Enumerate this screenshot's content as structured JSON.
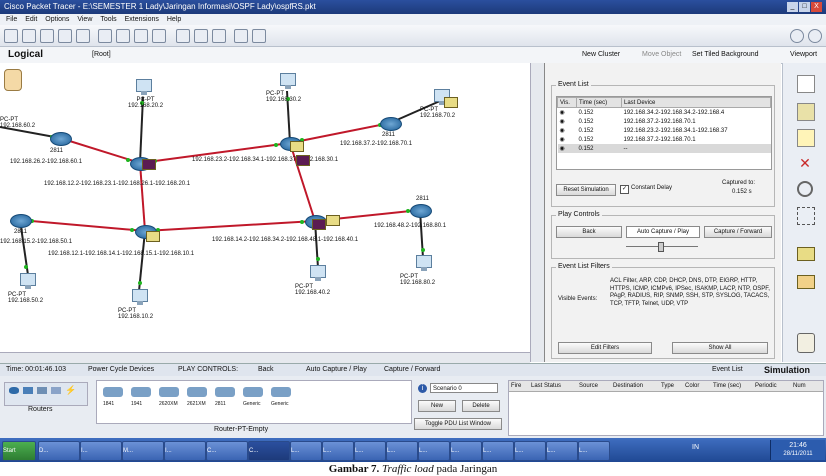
{
  "window": {
    "title": "Cisco Packet Tracer - E:\\SEMESTER 1 Lady\\Jaringan Informasi\\OSPF Lady\\ospfRS.pkt",
    "controls": [
      "_",
      "□",
      "X"
    ]
  },
  "menu": [
    "File",
    "Edit",
    "Options",
    "View",
    "Tools",
    "Extensions",
    "Help"
  ],
  "subbar": {
    "mode": "Logical",
    "root": "[Root]",
    "new_cluster": "New Cluster",
    "move_object": "Move Object",
    "set_tiled": "Set Tiled Background",
    "viewport": "Viewport"
  },
  "topology": {
    "nodes": [
      {
        "type": "pc",
        "label": "PC-PT\n192.168.20.2"
      },
      {
        "type": "pc",
        "label": "PC-PT\n192.168.30.2"
      },
      {
        "type": "pc",
        "label": "PC-PT\n192.168.70.2"
      },
      {
        "type": "pc",
        "label": "PC-PT\n192.168.60.2"
      },
      {
        "type": "pc",
        "label": "PC-PT\n192.168.50.2"
      },
      {
        "type": "pc",
        "label": "PC-PT\n192.168.10.2"
      },
      {
        "type": "pc",
        "label": "PC-PT\n192.168.40.2"
      },
      {
        "type": "pc",
        "label": "PC-PT\n192.168.80.2"
      },
      {
        "type": "router",
        "label": "2811"
      },
      {
        "type": "router",
        "label": "2811"
      },
      {
        "type": "router",
        "label": "2811"
      },
      {
        "type": "router",
        "label": "2811"
      },
      {
        "type": "router",
        "label": "2811"
      },
      {
        "type": "router",
        "label": "2811"
      }
    ],
    "link_labels": [
      "192.168.26.2-192.168.60.1",
      "192.168.12.2-192.168.23.1-192.168.26.1-192.168.20.1",
      "192.168.23.2-192.168.34.1-192.168.37.1-192.168.30.1",
      "192.168.37.2-192.168.70.1",
      "192.168.15.2-192.168.50.1",
      "192.168.12.1-192.168.14.1-192.168.15.1-192.168.10.1",
      "192.168.14.2-192.168.34.2-192.168.48.1-192.168.40.1",
      "192.168.48.2-192.168.80.1"
    ]
  },
  "event_list": {
    "title": "Event List",
    "headers": [
      "Vis.",
      "Time (sec)",
      "Last Device"
    ],
    "rows": [
      {
        "time": "0.152",
        "device": "192.168.34.2-192.168.34.2-192.168.4"
      },
      {
        "time": "0.152",
        "device": "192.168.37.2-192.168.70.1"
      },
      {
        "time": "0.152",
        "device": "192.168.23.2-192.168.34.1-192.168.37"
      },
      {
        "time": "0.152",
        "device": "192.168.37.2-192.168.70.1"
      },
      {
        "time": "0.152",
        "device": "--"
      }
    ],
    "reset_label": "Reset Simulation",
    "constant_delay": "Constant Delay",
    "captured_to_label": "Captured to:",
    "captured_to_value": "0.152 s"
  },
  "play_controls": {
    "title": "Play Controls",
    "back": "Back",
    "auto_capture": "Auto Capture / Play",
    "capture_forward": "Capture / Forward"
  },
  "filters": {
    "title": "Event List Filters",
    "visible_events_label": "Visible Events:",
    "visible_events": "ACL Filter, ARP, CDP, DHCP, DNS, DTP, EIGRP, HTTP, HTTPS, ICMP, ICMPv6, IPSec, ISAKMP, LACP, NTP, OSPF, PAgP, RADIUS, RIP, SNMP, SSH, STP, SYSLOG, TACACS, TCP, TFTP, Telnet, UDP, VTP",
    "edit_filters": "Edit Filters",
    "show_all": "Show All"
  },
  "statusbar": {
    "time": "Time: 00:01:46.103",
    "power_cycle": "Power Cycle Devices",
    "play_controls": "PLAY CONTROLS:",
    "back": "Back",
    "auto_capture": "Auto Capture / Play",
    "capture_forward": "Capture / Forward",
    "event_list": "Event List",
    "simulation": "Simulation"
  },
  "device_box": {
    "category": "Routers",
    "models": [
      "1841",
      "1941",
      "2620XM",
      "2621XM",
      "2811",
      "Generic",
      "Generic"
    ],
    "selected": "Router-PT-Empty"
  },
  "scenario": {
    "value": "Scenario 0",
    "new": "New",
    "delete": "Delete",
    "toggle": "Toggle PDU List Window"
  },
  "pdu_headers": [
    "Fire",
    "Last Status",
    "Source",
    "Destination",
    "Type",
    "Color",
    "Time (sec)",
    "Periodic",
    "Num"
  ],
  "taskbar": {
    "start": "Start",
    "items": [
      "D...",
      "I...",
      "M...",
      "I...",
      "C...",
      "C...",
      "L...",
      "L...",
      "L...",
      "L...",
      "L...",
      "L...",
      "L...",
      "L...",
      "L...",
      "L..."
    ],
    "lang": "IN",
    "clock_time": "21:46",
    "clock_date": "28/11/2011"
  },
  "caption": {
    "label": "Gambar 7.",
    "italic": "Traffic load",
    "rest": " pada Jaringan"
  },
  "colors": {
    "link_red": "#c0182a",
    "link_black": "#222222",
    "link_dot_green": "#1fb41f",
    "envelope": "#e8dc85",
    "envelope_dark": "#5b1b52",
    "titlebar": "#1d3a7a"
  }
}
